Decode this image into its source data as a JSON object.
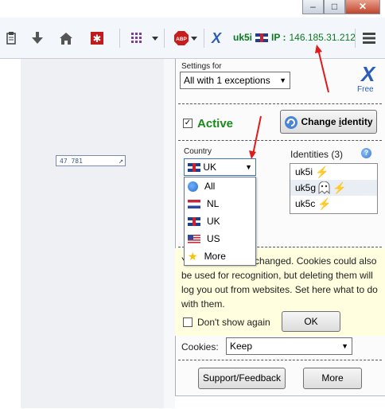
{
  "window": {
    "minimize": "–",
    "maximize": "□",
    "close": "✕"
  },
  "toolbar": {
    "icons": [
      "clipboard-icon",
      "download-icon",
      "home-icon",
      "lastpass-icon",
      "grid-icon",
      "adblock-icon"
    ],
    "adblock_label": "ABP",
    "vpn_letter": "X",
    "identity": "uk5i",
    "ip_label": "IP :",
    "ip_value": "146.185.31.212",
    "menu_icon": "hamburger-icon"
  },
  "page": {
    "mini_text": "47 781",
    "mini_arrow": "↗"
  },
  "panel": {
    "settings_for_label": "Settings for",
    "settings_for_value": "All with 1 exceptions",
    "brand_letter": "X",
    "brand_tier": "Free",
    "active_label": "Active",
    "active_checked": true,
    "change_identity_prefix": "Change ",
    "change_identity_accel": "i",
    "change_identity_suffix": "dentity",
    "country_label": "Country",
    "country_value": "UK",
    "identities_label": "Identities (3)",
    "identities": [
      {
        "name": "uk5i",
        "icon": "lightning-icon"
      },
      {
        "name": "uk5g",
        "icon": "ghost-lightning-icon"
      },
      {
        "name": "uk5c",
        "icon": "lightning-icon"
      }
    ],
    "country_options": [
      {
        "label": "All",
        "icon": "globe-icon"
      },
      {
        "label": "NL",
        "icon": "flag-nl-icon"
      },
      {
        "label": "UK",
        "icon": "flag-uk-icon"
      },
      {
        "label": "US",
        "icon": "flag-us-icon"
      },
      {
        "label": "More",
        "icon": "star-icon"
      }
    ],
    "note_text_line1": "Y",
    "note_text_line1_rest": "changed. Cookies could also",
    "note_text_rest": "be used for recognition, but deleting them will log you out from websites. Set here what to do with them.",
    "dont_show_label": "Don't show again",
    "ok_label": "OK",
    "cookies_label": "Cookies:",
    "cookies_value": "Keep",
    "support_label": "Support/Feedback",
    "more_label": "More"
  },
  "colors": {
    "accent_green": "#0a7a1f",
    "brand_blue": "#2a5db8",
    "note_bg": "#ffffdf",
    "arrow_red": "#e01b1b"
  }
}
